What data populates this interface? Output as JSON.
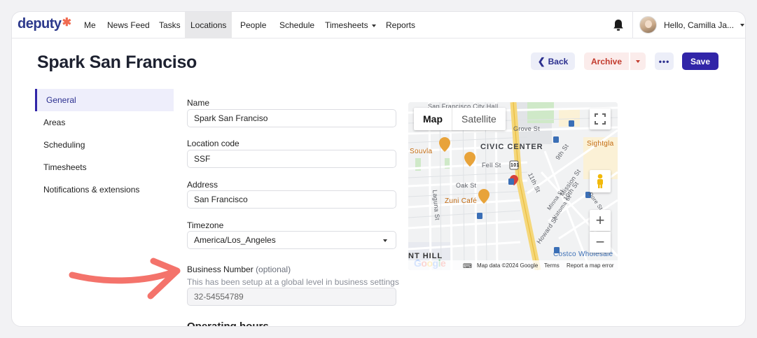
{
  "nav": {
    "logo": "deputy",
    "items": [
      "Me",
      "News Feed",
      "Tasks",
      "Locations",
      "People",
      "Schedule",
      "Timesheets",
      "Reports"
    ],
    "active": "Locations",
    "user_greeting": "Hello, Camilla Ja..."
  },
  "header": {
    "title": "Spark San Franciso",
    "back_label": "Back",
    "archive_label": "Archive",
    "more_label": "•••",
    "save_label": "Save"
  },
  "sidebar": {
    "items": [
      "General",
      "Areas",
      "Scheduling",
      "Timesheets",
      "Notifications & extensions"
    ],
    "active": "General"
  },
  "form": {
    "name_label": "Name",
    "name_value": "Spark San Franciso",
    "code_label": "Location code",
    "code_value": "SSF",
    "address_label": "Address",
    "address_value": "San Francisco",
    "timezone_label": "Timezone",
    "timezone_value": "America/Los_Angeles",
    "business_label": "Business Number",
    "business_optional": "(optional)",
    "business_hint": "This has been setup at a global level in business settings",
    "business_value": "32-54554789",
    "operating_hours": "Operating hours"
  },
  "map": {
    "tab_map": "Map",
    "tab_satellite": "Satellite",
    "labels": {
      "city_hall": "San Francisco City Hall",
      "civic_center": "CIVIC CENTER",
      "grove": "Grove St",
      "souvla": "Souvla",
      "fell": "Fell St",
      "oak": "Oak St",
      "zuni": "Zuni Café",
      "mission": "Mission St",
      "ninth": "9th St",
      "tenth": "10th St",
      "eleventh": "11th St",
      "howard": "Howard St",
      "laguna": "Laguna St",
      "minna": "Minna St",
      "natoma": "Natoma St",
      "dore": "Dore St",
      "sightglass": "Sightgla",
      "hill": "NT HILL",
      "costco": "Costco Wholesale",
      "hwy": "101"
    },
    "google": "Google",
    "footer_data": "Map data ©2024 Google",
    "footer_terms": "Terms",
    "footer_report": "Report a map error",
    "zoom_in": "+",
    "zoom_out": "−"
  },
  "colors": {
    "primary": "#3125a8",
    "archive": "#c23a2c",
    "logo_star": "#f06a50",
    "arrow": "#f4736b"
  },
  "icons": [
    "bell-icon",
    "chevron-left-icon",
    "caret-down-icon",
    "fullscreen-icon",
    "pegman-icon",
    "restaurant-pin-icon",
    "transit-icon",
    "keyboard-icon"
  ]
}
